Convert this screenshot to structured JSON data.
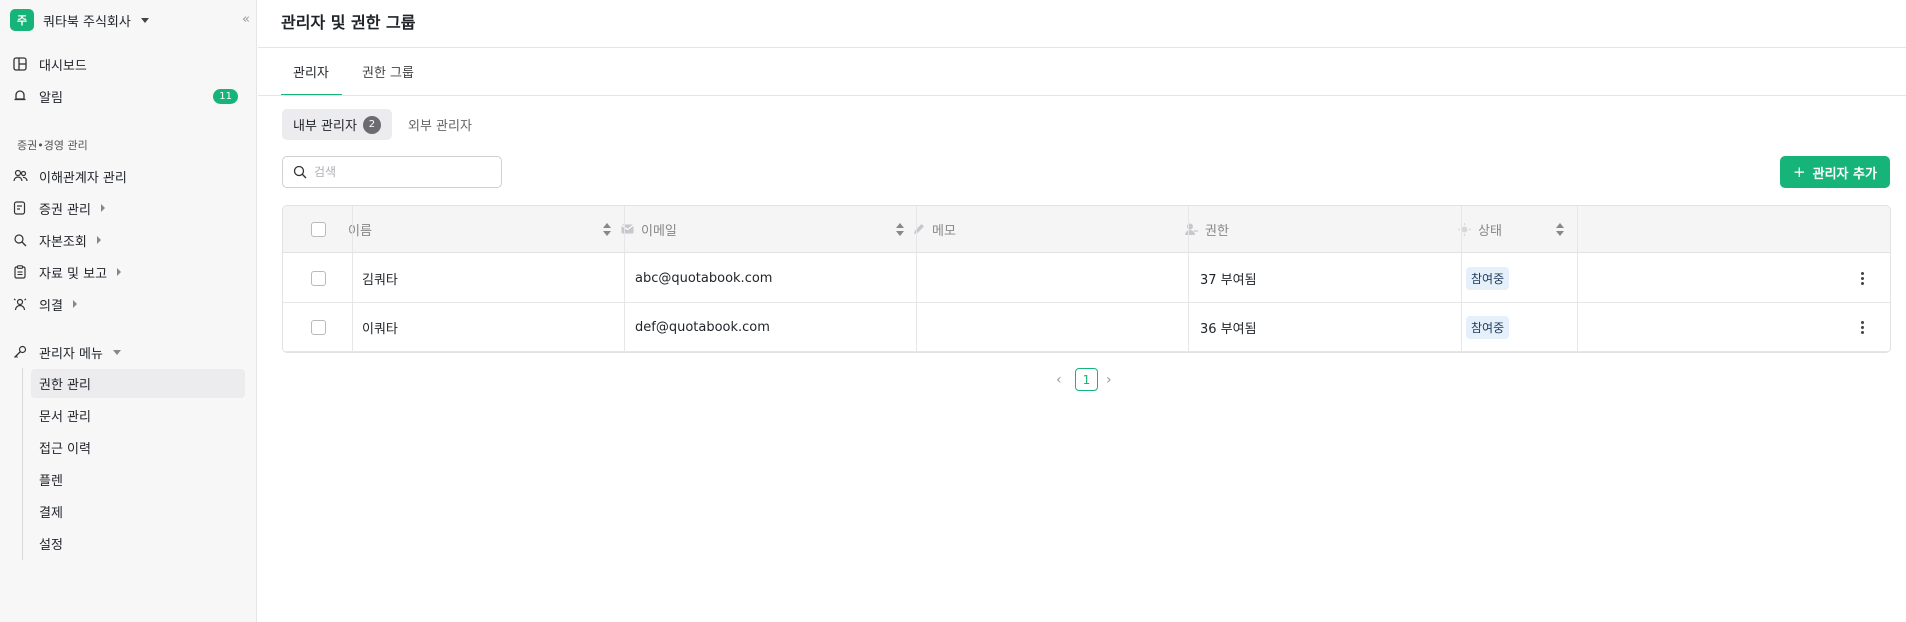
{
  "sidebar": {
    "org_badge": "주",
    "org_name": "쿼타북 주식회사",
    "collapse_label": "«",
    "items": [
      {
        "label": "대시보드",
        "icon": "dashboard-icon"
      },
      {
        "label": "알림",
        "icon": "bell-icon",
        "badge": "11"
      }
    ],
    "section_label": "증권•경영 관리",
    "section_items": [
      {
        "label": "이해관계자 관리",
        "icon": "people-icon"
      },
      {
        "label": "증권 관리",
        "icon": "certificate-icon"
      },
      {
        "label": "자본조회",
        "icon": "search-doc-icon"
      },
      {
        "label": "자료 및 보고",
        "icon": "clipboard-icon"
      },
      {
        "label": "의결",
        "icon": "vote-icon"
      }
    ],
    "admin_menu_label": "관리자 메뉴",
    "admin_submenu": [
      "권한 관리",
      "문서 관리",
      "접근 이력",
      "플렌",
      "결제",
      "설정"
    ],
    "active_submenu": "권한 관리"
  },
  "main": {
    "title": "관리자 및 권한 그룹",
    "tabs": [
      {
        "label": "관리자",
        "active": true
      },
      {
        "label": "권한 그룹",
        "active": false
      }
    ],
    "segments": [
      {
        "label": "내부 관리자",
        "count": "2",
        "active": true
      },
      {
        "label": "외부 관리자",
        "active": false
      }
    ],
    "search": {
      "placeholder": "검색",
      "value": ""
    },
    "add_button": "관리자 추가",
    "table": {
      "columns": [
        "이름",
        "이메일",
        "메모",
        "권한",
        "상태"
      ],
      "rows": [
        {
          "name": "김쿼타",
          "email": "abc@quotabook.com",
          "memo": "",
          "permission": "37 부여됨",
          "status": "참여중"
        },
        {
          "name": "이쿼타",
          "email": "def@quotabook.com",
          "memo": "",
          "permission": "36 부여됨",
          "status": "참여중"
        }
      ]
    },
    "pagination": {
      "current": "1",
      "prev": "‹",
      "next": "›"
    }
  },
  "colors": {
    "accent": "#17b479",
    "status_bg": "#e6f0fb"
  }
}
